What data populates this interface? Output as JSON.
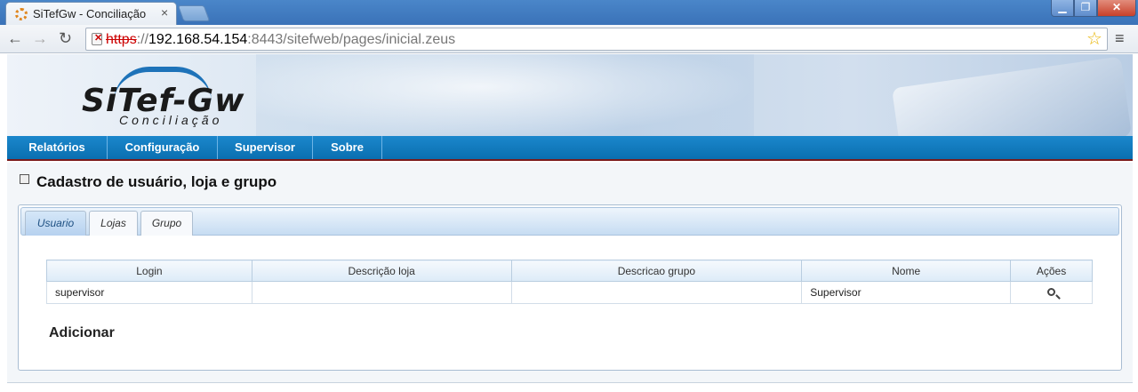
{
  "browser": {
    "tab_title": "SiTefGw - Conciliação",
    "url_scheme": "https",
    "url_sep": "://",
    "url_host": "192.168.54.154",
    "url_rest": ":8443/sitefweb/pages/inicial.zeus",
    "window_min": "▁",
    "window_max": "❐",
    "window_close": "✕",
    "back": "←",
    "forward": "→",
    "reload": "↻",
    "star": "☆",
    "menu": "≡"
  },
  "logo": {
    "name": "SiTef-Gw",
    "subtitle": "Conciliação"
  },
  "nav": {
    "items": [
      "Relatórios",
      "Configuração",
      "Supervisor",
      "Sobre"
    ]
  },
  "page": {
    "title": "Cadastro de usuário, loja e grupo"
  },
  "tabs": {
    "items": [
      "Usuario",
      "Lojas",
      "Grupo"
    ],
    "active": 0
  },
  "table": {
    "columns": [
      "Login",
      "Descrição loja",
      "Descricao grupo",
      "Nome",
      "Ações"
    ],
    "rows": [
      {
        "login": "supervisor",
        "descricao_loja": "",
        "descricao_grupo": "",
        "nome": "Supervisor",
        "acao_icon": "zoom-icon"
      }
    ]
  },
  "actions": {
    "add_label": "Adicionar"
  }
}
